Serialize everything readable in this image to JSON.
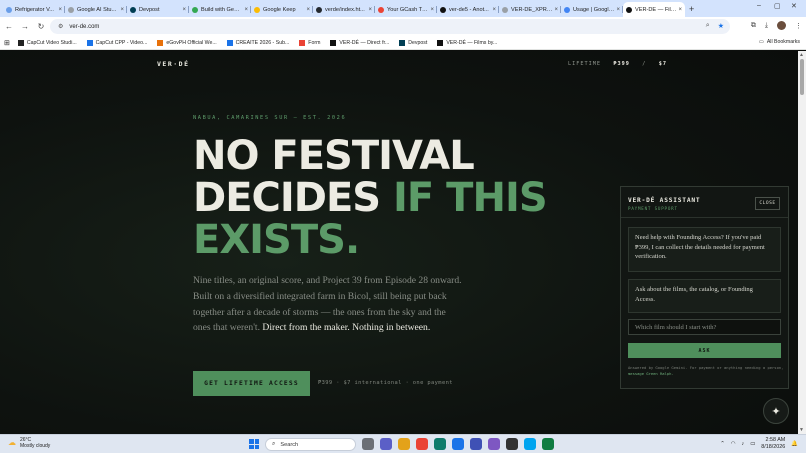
{
  "browser": {
    "tabs": [
      {
        "label": "Refrigerator V...",
        "color": "#6a9ee8"
      },
      {
        "label": "Google AI Stu...",
        "color": "#9aa0a6"
      },
      {
        "label": "Devpost",
        "color": "#003e54"
      },
      {
        "label": "Build with Gem...",
        "color": "#34a853"
      },
      {
        "label": "Google Keep",
        "color": "#fbbc04"
      },
      {
        "label": "verde/index.ht...",
        "color": "#24292f"
      },
      {
        "label": "Your GCash Tra...",
        "color": "#ea4335"
      },
      {
        "label": "ver-de5 - Anot...",
        "color": "#111111"
      },
      {
        "label": "VER-DE_XPR2...",
        "color": "#9aa0a6"
      },
      {
        "label": "Usage | Google...",
        "color": "#4285f4"
      },
      {
        "label": "VER-DÉ — Film...",
        "color": "#111111"
      }
    ],
    "active_tab_index": 10,
    "new_tab_symbol": "+",
    "url": "ver-de.com",
    "bookmarks": [
      {
        "label": "CapCut Video Studi...",
        "color": "#222222"
      },
      {
        "label": "CapCut CPP - Video...",
        "color": "#1a73e8"
      },
      {
        "label": "eGovPH Official We...",
        "color": "#e8710a"
      },
      {
        "label": "CREAITE 2026 - Sub...",
        "color": "#1a73e8"
      },
      {
        "label": "Form",
        "color": "#ea4335"
      },
      {
        "label": "VER-DÉ — Direct fr...",
        "color": "#111111"
      },
      {
        "label": "Devpost",
        "color": "#003e54"
      },
      {
        "label": "VER-DÉ — Films by...",
        "color": "#111111"
      }
    ],
    "all_bookmarks_label": "All Bookmarks"
  },
  "site": {
    "logo": "VER·DÉ",
    "lifetime_prefix": "LIFETIME",
    "lifetime_php": "₱399",
    "lifetime_sep": "/",
    "lifetime_usd": "$7",
    "eyebrow": "NABUA, CAMARINES SUR — EST. 2026",
    "headline_line1": "NO FESTIVAL",
    "headline_line2_white": "DECIDES",
    "headline_line2_green": "IF THIS",
    "headline_line3": "EXISTS.",
    "body_text": "Nine titles, an original score, and Project 39 from Episode 28 onward. Built on a diversified integrated farm in Bicol, still being put back together after a decade of storms — the ones from the sky and the ones that weren't.",
    "body_strong": "Direct from the maker. Nothing in between.",
    "cta_label": "GET LIFETIME ACCESS",
    "cta_note": "₱399 · $7 international · one payment"
  },
  "assistant": {
    "title": "VER-DÉ ASSISTANT",
    "subtitle": "PAYMENT SUPPORT",
    "close_label": "CLOSE",
    "message_1": "Need help with Founding Access? If you've paid ₱399, I can collect the details needed for payment verification.",
    "message_2": "Ask about the films, the catalog, or Founding Access.",
    "input_placeholder": "Which film should I start with?",
    "ask_label": "ASK",
    "footer_text": "Answered by Google Gemini. For payment or anything needing a person,",
    "footer_link": "message Green Ralph."
  },
  "taskbar": {
    "temp": "26°C",
    "weather": "Mostly cloudy",
    "search_label": "Search",
    "time": "2:58 AM",
    "date": "8/18/2026",
    "apps": [
      "#6b6f76",
      "#5b5fc7",
      "#e3a21a",
      "#ea4335",
      "#0f7b6c",
      "#1a73e8",
      "#3f51b5",
      "#7e57c2",
      "#333333",
      "#00a4ef",
      "#107c41"
    ]
  }
}
